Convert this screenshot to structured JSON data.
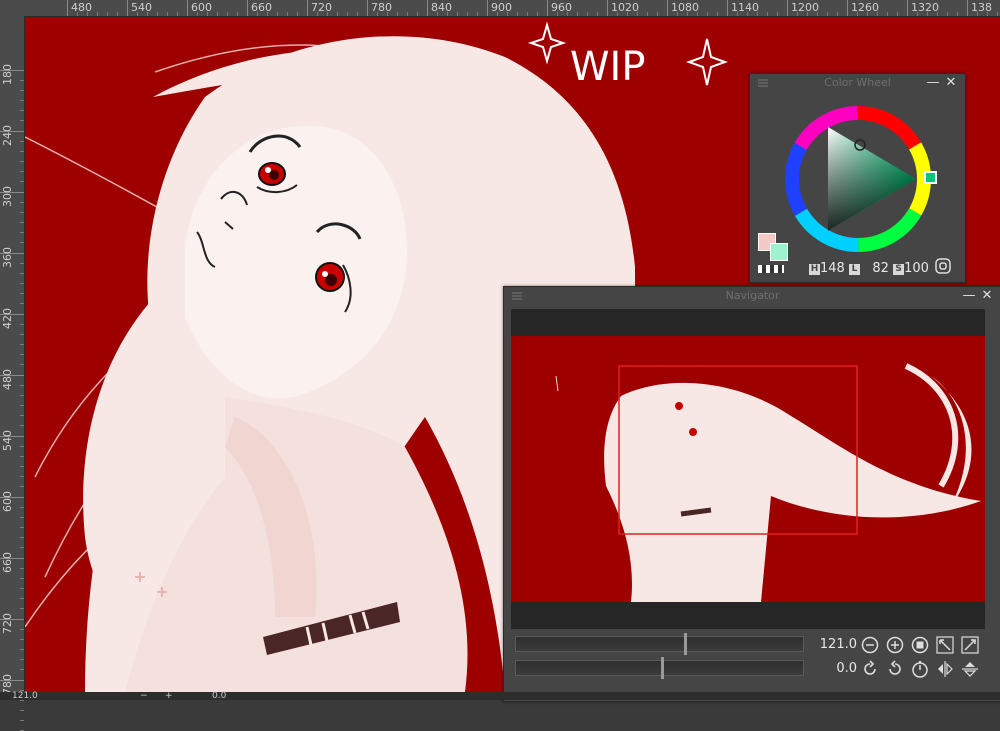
{
  "ruler": {
    "top_labels": [
      "480",
      "540",
      "600",
      "660",
      "720",
      "780",
      "840",
      "900",
      "960",
      "1020",
      "1080",
      "1140",
      "1200",
      "1260",
      "1320",
      "138"
    ],
    "left_labels": [
      "180",
      "240",
      "300",
      "360",
      "420",
      "480",
      "540",
      "600",
      "660",
      "720",
      "780"
    ]
  },
  "artwork": {
    "wip_text": "WIP",
    "background_color": "#9e0000",
    "figure_color": "#f7e8e6",
    "eye_color": "#d40000"
  },
  "color_wheel": {
    "title": "Color Wheel",
    "minimize": "—",
    "close": "✕",
    "h_label": "H",
    "h_value": "148",
    "l_label": "L",
    "l_value": "82",
    "s_label": "S",
    "s_value": "100",
    "main_color": "#f5c9c6",
    "sub_color": "#9ff2cf"
  },
  "navigator": {
    "title": "Navigator",
    "minimize": "—",
    "close": "✕",
    "zoom_value": "121.0",
    "zoom_level": 0.58,
    "rotation_value": "0.0",
    "rotation_level": 0.5
  },
  "status": {
    "zoom": "121.0",
    "rotation": "0.0"
  }
}
